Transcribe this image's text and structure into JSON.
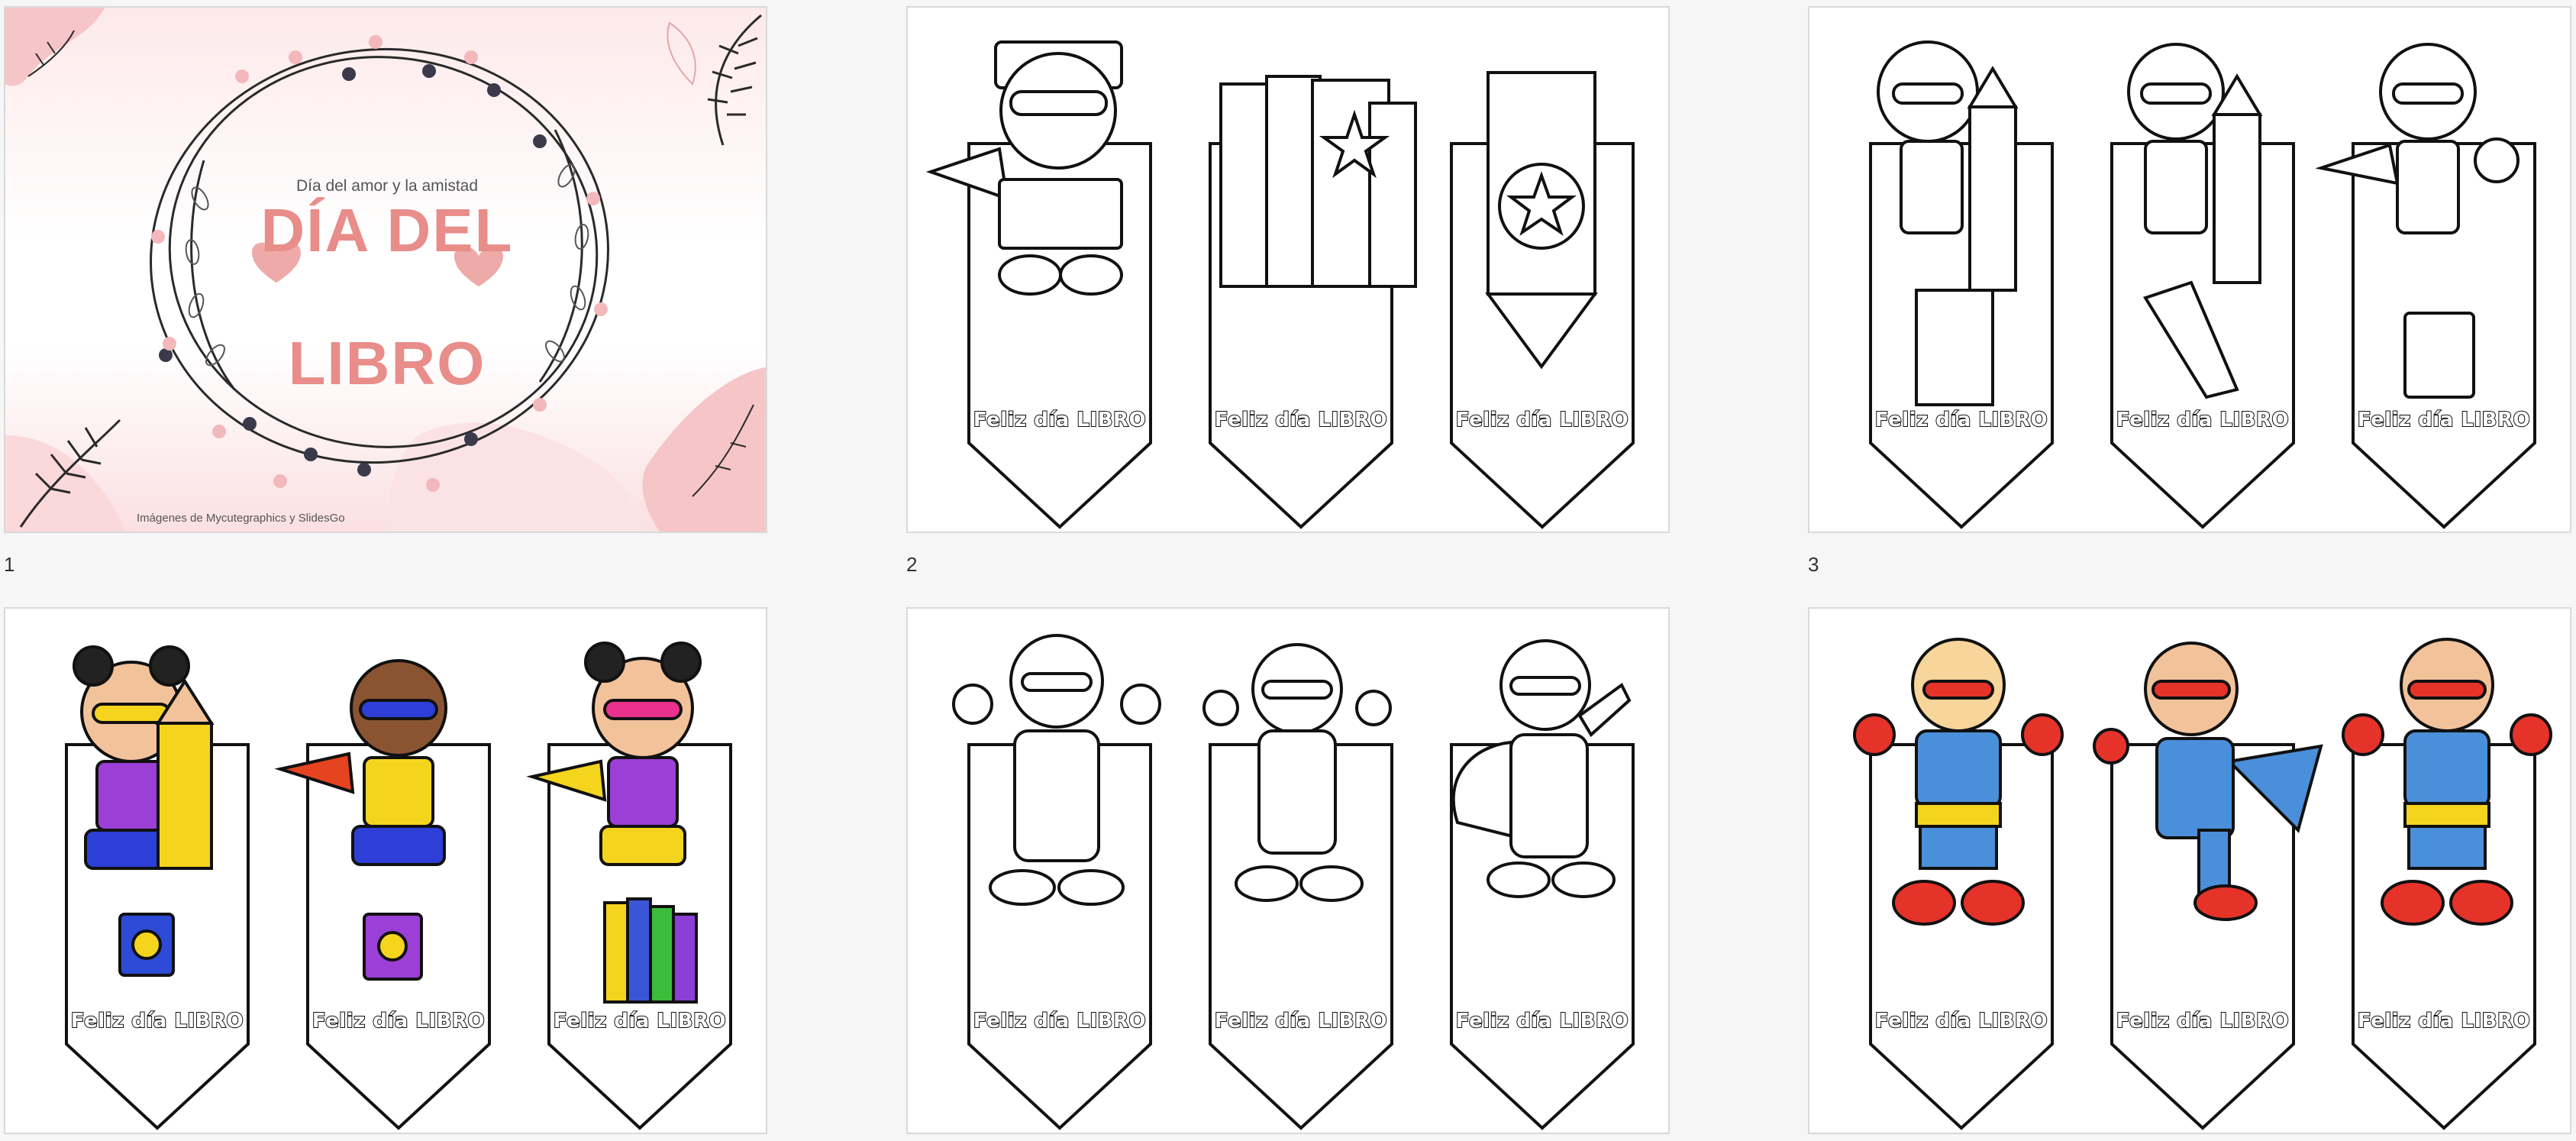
{
  "slides": [
    {
      "number": "1",
      "type": "cover",
      "subtitle": "Día del amor y la amistad",
      "title_line1": "DÍA DEL",
      "title_line2": "LIBRO",
      "credit": "Imágenes de Mycutegraphics y SlidesGo"
    },
    {
      "number": "2",
      "type": "bookmarks",
      "colored": false,
      "bookmarks": [
        {
          "label": "Feliz día LIBRO",
          "art": "superhero-kid-sign"
        },
        {
          "label": "Feliz día LIBRO",
          "art": "books-stack"
        },
        {
          "label": "Feliz día LIBRO",
          "art": "pencil-star"
        }
      ]
    },
    {
      "number": "3",
      "type": "bookmarks",
      "colored": false,
      "bookmarks": [
        {
          "label": "Feliz día LIBRO",
          "art": "superhero-girl-pencil-books"
        },
        {
          "label": "Feliz día LIBRO",
          "art": "superhero-boy-pencil"
        },
        {
          "label": "Feliz día LIBRO",
          "art": "superhero-boy-book"
        }
      ]
    },
    {
      "number": "",
      "type": "bookmarks",
      "colored": true,
      "bookmarks": [
        {
          "label": "Feliz día LIBRO",
          "art": "superhero-girl-pencil-color"
        },
        {
          "label": "Feliz día LIBRO",
          "art": "superhero-boy-cape-color"
        },
        {
          "label": "Feliz día LIBRO",
          "art": "superhero-girl-books-color"
        }
      ]
    },
    {
      "number": "",
      "type": "bookmarks",
      "colored": false,
      "bookmarks": [
        {
          "label": "Feliz día LIBRO",
          "art": "superhero-girl-flex"
        },
        {
          "label": "Feliz día LIBRO",
          "art": "superhero-boy-flex"
        },
        {
          "label": "Feliz día LIBRO",
          "art": "superhero-girl-wave"
        }
      ]
    },
    {
      "number": "",
      "type": "bookmarks",
      "colored": true,
      "bookmarks": [
        {
          "label": "Feliz día LIBRO",
          "art": "superhero-boy-color"
        },
        {
          "label": "Feliz día LIBRO",
          "art": "superhero-girl-fly-color"
        },
        {
          "label": "Feliz día LIBRO",
          "art": "superhero-girl-color"
        }
      ]
    }
  ],
  "colors": {
    "accent": "#e88d8a",
    "canvas": "#f6f6f6",
    "outline": "#111111"
  }
}
